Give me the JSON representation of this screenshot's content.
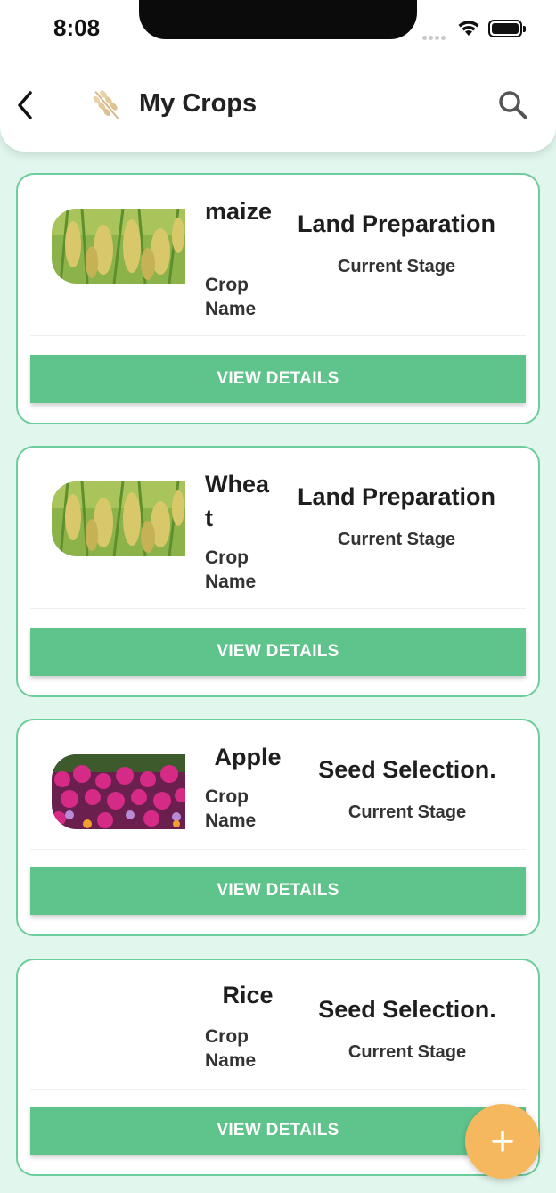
{
  "status_bar": {
    "time": "8:08"
  },
  "header": {
    "title": "My Crops"
  },
  "crops": [
    {
      "name": "maize",
      "name_label": "Crop Name",
      "stage": "Land Preparation",
      "stage_label": "Current Stage",
      "button": "VIEW DETAILS"
    },
    {
      "name": "Wheat",
      "name_label": "Crop Name",
      "stage": "Land Preparation",
      "stage_label": "Current Stage",
      "button": "VIEW DETAILS"
    },
    {
      "name": "Apple",
      "name_label": "Crop Name",
      "stage": "Seed Selection.",
      "stage_label": "Current Stage",
      "button": "VIEW DETAILS"
    },
    {
      "name": "Rice",
      "name_label": "Crop Name",
      "stage": "Seed Selection.",
      "stage_label": "Current Stage",
      "button": "VIEW DETAILS"
    }
  ],
  "fab": {
    "icon": "plus-icon"
  },
  "colors": {
    "accent": "#5fc48b",
    "background": "#e1f7ee",
    "fab": "#f5b85e"
  }
}
